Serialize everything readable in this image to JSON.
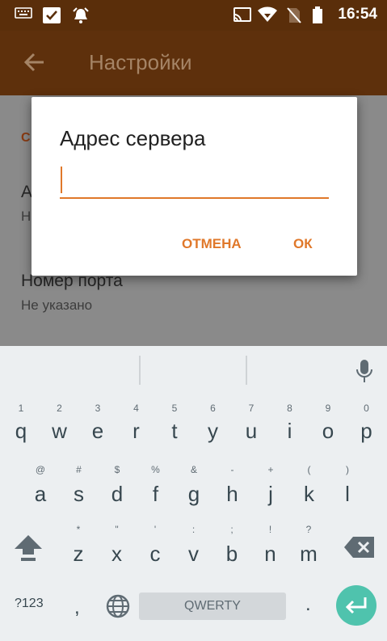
{
  "status_bar": {
    "time": "16:54",
    "icons": [
      "keyboard-icon",
      "check-box-icon",
      "alarm-icon",
      "cast-icon",
      "wifi-icon",
      "no-sim-icon",
      "battery-icon"
    ]
  },
  "app_bar": {
    "title": "Настройки",
    "back_icon": "arrow-back-icon"
  },
  "background_prefs": {
    "category_initial": "С",
    "item1_title_initial": "А",
    "item1_sub_initial": "Н",
    "item2_title": "Номер порта",
    "item2_sub": "Не указано"
  },
  "dialog": {
    "title": "Адрес сервера",
    "input_value": "",
    "cancel_label": "ОТМЕНА",
    "ok_label": "ОК",
    "accent_color": "#e0782a"
  },
  "keyboard": {
    "row1": [
      {
        "key": "q",
        "hint": "1"
      },
      {
        "key": "w",
        "hint": "2"
      },
      {
        "key": "e",
        "hint": "3"
      },
      {
        "key": "r",
        "hint": "4"
      },
      {
        "key": "t",
        "hint": "5"
      },
      {
        "key": "y",
        "hint": "6"
      },
      {
        "key": "u",
        "hint": "7"
      },
      {
        "key": "i",
        "hint": "8"
      },
      {
        "key": "o",
        "hint": "9"
      },
      {
        "key": "p",
        "hint": "0"
      }
    ],
    "row2": [
      {
        "key": "a",
        "hint": "@"
      },
      {
        "key": "s",
        "hint": "#"
      },
      {
        "key": "d",
        "hint": "$"
      },
      {
        "key": "f",
        "hint": "%"
      },
      {
        "key": "g",
        "hint": "&"
      },
      {
        "key": "h",
        "hint": "-"
      },
      {
        "key": "j",
        "hint": "+"
      },
      {
        "key": "k",
        "hint": "("
      },
      {
        "key": "l",
        "hint": ")"
      }
    ],
    "row3": [
      {
        "key": "z",
        "hint": "*"
      },
      {
        "key": "x",
        "hint": "\""
      },
      {
        "key": "c",
        "hint": "'"
      },
      {
        "key": "v",
        "hint": ":"
      },
      {
        "key": "b",
        "hint": ";"
      },
      {
        "key": "n",
        "hint": "!"
      },
      {
        "key": "m",
        "hint": "?"
      }
    ],
    "symbols_label": "?123",
    "comma": ",",
    "space_label": "QWERTY",
    "period": ".",
    "enter_color": "#4fc3ad"
  }
}
